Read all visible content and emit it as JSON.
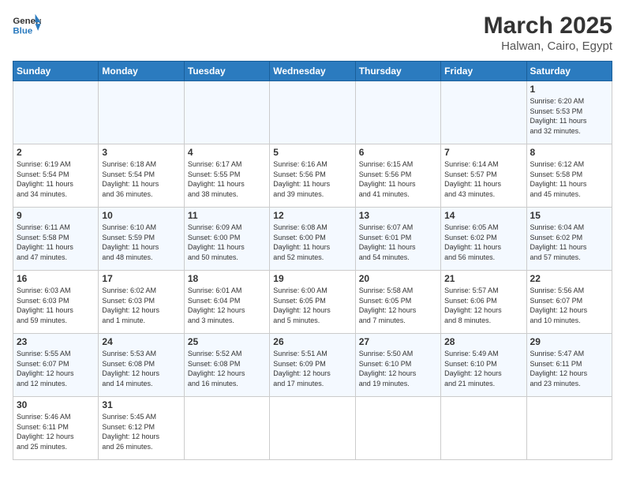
{
  "header": {
    "logo_general": "General",
    "logo_blue": "Blue",
    "month_year": "March 2025",
    "location": "Halwan, Cairo, Egypt"
  },
  "days_of_week": [
    "Sunday",
    "Monday",
    "Tuesday",
    "Wednesday",
    "Thursday",
    "Friday",
    "Saturday"
  ],
  "weeks": [
    [
      {
        "day": "",
        "info": ""
      },
      {
        "day": "",
        "info": ""
      },
      {
        "day": "",
        "info": ""
      },
      {
        "day": "",
        "info": ""
      },
      {
        "day": "",
        "info": ""
      },
      {
        "day": "",
        "info": ""
      },
      {
        "day": "1",
        "info": "Sunrise: 6:20 AM\nSunset: 5:53 PM\nDaylight: 11 hours\nand 32 minutes."
      }
    ],
    [
      {
        "day": "2",
        "info": "Sunrise: 6:19 AM\nSunset: 5:54 PM\nDaylight: 11 hours\nand 34 minutes."
      },
      {
        "day": "3",
        "info": "Sunrise: 6:18 AM\nSunset: 5:54 PM\nDaylight: 11 hours\nand 36 minutes."
      },
      {
        "day": "4",
        "info": "Sunrise: 6:17 AM\nSunset: 5:55 PM\nDaylight: 11 hours\nand 38 minutes."
      },
      {
        "day": "5",
        "info": "Sunrise: 6:16 AM\nSunset: 5:56 PM\nDaylight: 11 hours\nand 39 minutes."
      },
      {
        "day": "6",
        "info": "Sunrise: 6:15 AM\nSunset: 5:56 PM\nDaylight: 11 hours\nand 41 minutes."
      },
      {
        "day": "7",
        "info": "Sunrise: 6:14 AM\nSunset: 5:57 PM\nDaylight: 11 hours\nand 43 minutes."
      },
      {
        "day": "8",
        "info": "Sunrise: 6:12 AM\nSunset: 5:58 PM\nDaylight: 11 hours\nand 45 minutes."
      }
    ],
    [
      {
        "day": "9",
        "info": "Sunrise: 6:11 AM\nSunset: 5:58 PM\nDaylight: 11 hours\nand 47 minutes."
      },
      {
        "day": "10",
        "info": "Sunrise: 6:10 AM\nSunset: 5:59 PM\nDaylight: 11 hours\nand 48 minutes."
      },
      {
        "day": "11",
        "info": "Sunrise: 6:09 AM\nSunset: 6:00 PM\nDaylight: 11 hours\nand 50 minutes."
      },
      {
        "day": "12",
        "info": "Sunrise: 6:08 AM\nSunset: 6:00 PM\nDaylight: 11 hours\nand 52 minutes."
      },
      {
        "day": "13",
        "info": "Sunrise: 6:07 AM\nSunset: 6:01 PM\nDaylight: 11 hours\nand 54 minutes."
      },
      {
        "day": "14",
        "info": "Sunrise: 6:05 AM\nSunset: 6:02 PM\nDaylight: 11 hours\nand 56 minutes."
      },
      {
        "day": "15",
        "info": "Sunrise: 6:04 AM\nSunset: 6:02 PM\nDaylight: 11 hours\nand 57 minutes."
      }
    ],
    [
      {
        "day": "16",
        "info": "Sunrise: 6:03 AM\nSunset: 6:03 PM\nDaylight: 11 hours\nand 59 minutes."
      },
      {
        "day": "17",
        "info": "Sunrise: 6:02 AM\nSunset: 6:03 PM\nDaylight: 12 hours\nand 1 minute."
      },
      {
        "day": "18",
        "info": "Sunrise: 6:01 AM\nSunset: 6:04 PM\nDaylight: 12 hours\nand 3 minutes."
      },
      {
        "day": "19",
        "info": "Sunrise: 6:00 AM\nSunset: 6:05 PM\nDaylight: 12 hours\nand 5 minutes."
      },
      {
        "day": "20",
        "info": "Sunrise: 5:58 AM\nSunset: 6:05 PM\nDaylight: 12 hours\nand 7 minutes."
      },
      {
        "day": "21",
        "info": "Sunrise: 5:57 AM\nSunset: 6:06 PM\nDaylight: 12 hours\nand 8 minutes."
      },
      {
        "day": "22",
        "info": "Sunrise: 5:56 AM\nSunset: 6:07 PM\nDaylight: 12 hours\nand 10 minutes."
      }
    ],
    [
      {
        "day": "23",
        "info": "Sunrise: 5:55 AM\nSunset: 6:07 PM\nDaylight: 12 hours\nand 12 minutes."
      },
      {
        "day": "24",
        "info": "Sunrise: 5:53 AM\nSunset: 6:08 PM\nDaylight: 12 hours\nand 14 minutes."
      },
      {
        "day": "25",
        "info": "Sunrise: 5:52 AM\nSunset: 6:08 PM\nDaylight: 12 hours\nand 16 minutes."
      },
      {
        "day": "26",
        "info": "Sunrise: 5:51 AM\nSunset: 6:09 PM\nDaylight: 12 hours\nand 17 minutes."
      },
      {
        "day": "27",
        "info": "Sunrise: 5:50 AM\nSunset: 6:10 PM\nDaylight: 12 hours\nand 19 minutes."
      },
      {
        "day": "28",
        "info": "Sunrise: 5:49 AM\nSunset: 6:10 PM\nDaylight: 12 hours\nand 21 minutes."
      },
      {
        "day": "29",
        "info": "Sunrise: 5:47 AM\nSunset: 6:11 PM\nDaylight: 12 hours\nand 23 minutes."
      }
    ],
    [
      {
        "day": "30",
        "info": "Sunrise: 5:46 AM\nSunset: 6:11 PM\nDaylight: 12 hours\nand 25 minutes."
      },
      {
        "day": "31",
        "info": "Sunrise: 5:45 AM\nSunset: 6:12 PM\nDaylight: 12 hours\nand 26 minutes."
      },
      {
        "day": "",
        "info": ""
      },
      {
        "day": "",
        "info": ""
      },
      {
        "day": "",
        "info": ""
      },
      {
        "day": "",
        "info": ""
      },
      {
        "day": "",
        "info": ""
      }
    ]
  ]
}
